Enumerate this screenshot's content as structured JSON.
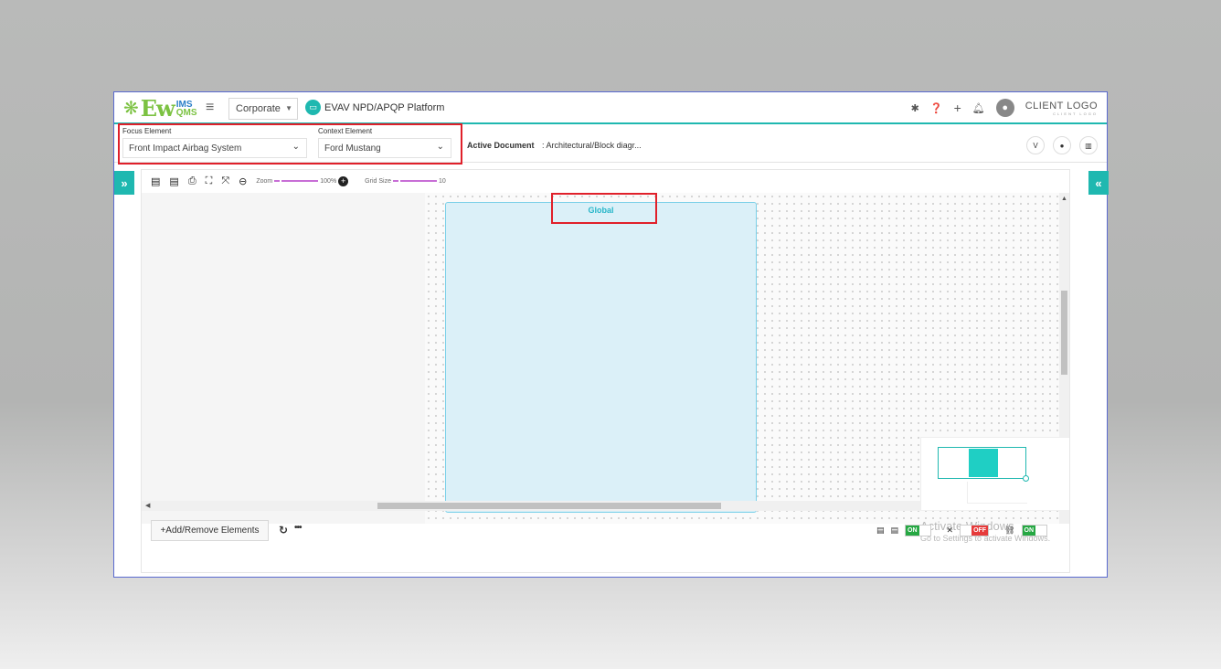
{
  "header": {
    "logo_main": "Ew",
    "logo_ims": "IMS",
    "logo_qms": "QMS",
    "org_select": "Corporate",
    "platform_title": "EVAV NPD/APQP Platform",
    "client_logo": "CLIENT LOGO",
    "client_logo_sub": "CLIENT LOGO"
  },
  "context": {
    "focus_label": "Focus Element",
    "focus_value": "Front Impact Airbag System",
    "context_label": "Context Element",
    "context_value": "Ford Mustang",
    "active_doc_label": "Active Document",
    "active_doc_value": ": Architectural/Block diagr..."
  },
  "toolbar": {
    "zoom_label": "Zoom",
    "zoom_value": "100%",
    "zoom_level": 100,
    "grid_label": "Grid Size",
    "grid_value": "10"
  },
  "canvas": {
    "global_title": "Global"
  },
  "bottom": {
    "add_remove_label": "+Add/Remove Elements",
    "toggle1": "ON",
    "toggle2": "OFF",
    "toggle3": "ON"
  },
  "watermark": {
    "line1": "Activate Windows",
    "line2": "Go to Settings to activate Windows."
  },
  "colors": {
    "accent": "#1fb8b0",
    "highlight_box": "#e0202a",
    "global_fill": "#dbf0f8",
    "on_green": "#26a843",
    "off_red": "#e63b3b"
  }
}
